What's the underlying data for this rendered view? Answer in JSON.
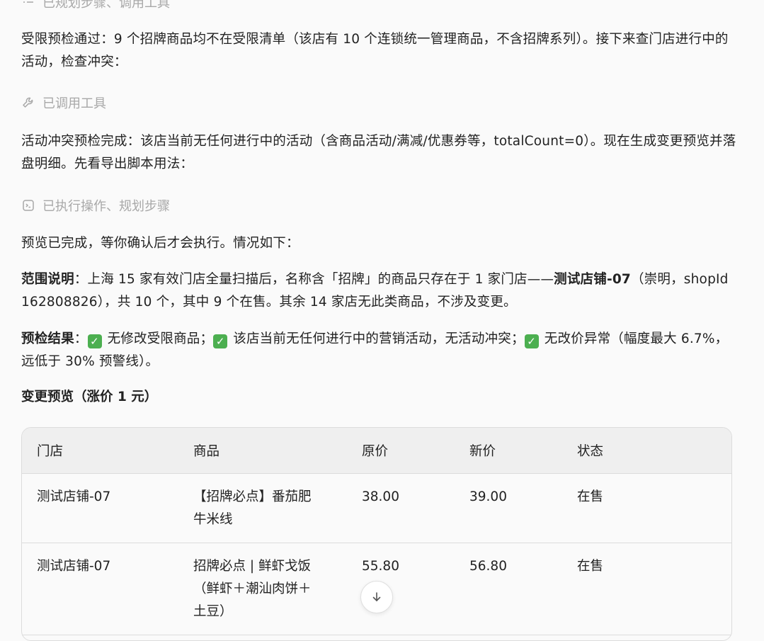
{
  "steps": {
    "planned_tools": "已规划步骤、调用工具",
    "called_tool": "已调用工具",
    "executed_plan": "已执行操作、规划步骤"
  },
  "messages": {
    "restricted_check": "受限预检通过：9 个招牌商品均不在受限清单（该店有 10 个连锁统一管理商品，不含招牌系列）。接下来查门店进行中的活动，检查冲突：",
    "conflict_check": "活动冲突预检完成：该店当前无任何进行中的活动（含商品活动/满减/优惠券等，totalCount=0）。现在生成变更预览并落盘明细。先看导出脚本用法：",
    "preview_done": "预览已完成，等你确认后才会执行。情况如下：",
    "scope_label": "范围说明",
    "scope_text_1": "：上海 15 家有效门店全量扫描后，名称含「招牌」的商品只存在于 1 家门店——",
    "scope_store": "测试店铺-07",
    "scope_text_2": "（崇明，shopId 162808826），共 10 个，其中 9 个在售。其余 14 家店无此类商品，不涉及变更。",
    "result_label": "预检结果",
    "result_colon": "：",
    "result_1": " 无修改受限商品；",
    "result_2": " 该店当前无任何进行中的营销活动，无活动冲突；",
    "result_3": " 无改价异常（幅度最大 6.7%，远低于 30% 预警线）。",
    "section_title": "变更预览（涨价 1 元）"
  },
  "table": {
    "headers": [
      "门店",
      "商品",
      "原价",
      "新价",
      "状态"
    ],
    "rows": [
      {
        "store": "测试店铺-07",
        "product": "【招牌必点】番茄肥牛米线",
        "old_price": "38.00",
        "new_price": "39.00",
        "status": "在售"
      },
      {
        "store": "测试店铺-07",
        "product": "招牌必点 | 鲜虾戈饭（鲜虾＋潮汕肉饼＋土豆）",
        "old_price": "55.80",
        "new_price": "56.80",
        "status": "在售"
      }
    ]
  },
  "icons": {
    "step_plan": "list-icon",
    "step_tool": "wrench-icon",
    "step_exec": "terminal-icon",
    "check": "check-box-icon",
    "scroll": "arrow-down-icon"
  },
  "colors": {
    "check_green": "#4caf50",
    "muted_text": "#a8a8a8",
    "table_header_bg": "#efefef"
  }
}
